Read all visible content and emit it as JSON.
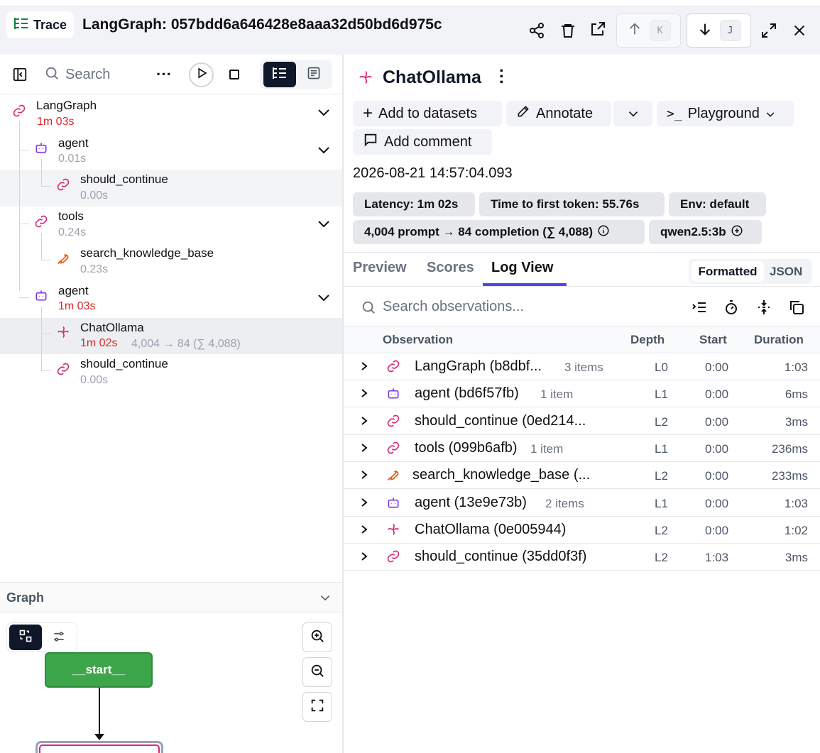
{
  "header": {
    "badge_label": "Trace",
    "title": "LangGraph: 057bdd6a646428e8aaa32d50bd6d975c",
    "prev_key": "K",
    "next_key": "J"
  },
  "left": {
    "search_label": "Search",
    "tree": [
      {
        "name": "LangGraph",
        "duration": "1m 03s",
        "dur_color": "red"
      },
      {
        "name": "agent",
        "duration": "0.01s",
        "dur_color": "gray"
      },
      {
        "name": "should_continue",
        "duration": "0.00s",
        "dur_color": "gray"
      },
      {
        "name": "tools",
        "duration": "0.24s",
        "dur_color": "gray"
      },
      {
        "name": "search_knowledge_base",
        "duration": "0.23s",
        "dur_color": "gray"
      },
      {
        "name": "agent",
        "duration": "1m 03s",
        "dur_color": "red"
      },
      {
        "name": "ChatOllama",
        "duration": "1m 02s",
        "tokens": "4,004 → 84 (∑ 4,088)",
        "dur_color": "red"
      },
      {
        "name": "should_continue",
        "duration": "0.00s",
        "dur_color": "gray"
      }
    ],
    "graph_label": "Graph",
    "graph_node_start": "__start__"
  },
  "right": {
    "obs_title": "ChatOllama",
    "buttons": {
      "add_to_datasets": "Add to datasets",
      "annotate": "Annotate",
      "playground": "Playground",
      "add_comment": "Add comment"
    },
    "timestamp": "2026-08-21 14:57:04.093",
    "tags": {
      "latency": "Latency: 1m 02s",
      "ttft": "Time to first token: 55.76s",
      "env": "Env: default",
      "tokens": "4,004 prompt → 84 completion (∑ 4,088)",
      "model": "qwen2.5:3b"
    },
    "tabs": {
      "preview": "Preview",
      "scores": "Scores",
      "log_view": "Log View"
    },
    "view_toggle": {
      "formatted": "Formatted",
      "json": "JSON"
    },
    "search_placeholder": "Search observations...",
    "columns": {
      "observation": "Observation",
      "depth": "Depth",
      "start": "Start",
      "duration": "Duration"
    },
    "rows": [
      {
        "name": "LangGraph (b8dbf...",
        "items": "3 items",
        "depth": "L0",
        "start": "0:00",
        "duration": "1:03",
        "icon": "link"
      },
      {
        "name": "agent (bd6f57fb)",
        "items": "1 item",
        "depth": "L1",
        "start": "0:00",
        "duration": "6ms",
        "icon": "bot"
      },
      {
        "name": "should_continue (0ed214...",
        "items": "",
        "depth": "L2",
        "start": "0:00",
        "duration": "3ms",
        "icon": "link"
      },
      {
        "name": "tools (099b6afb)",
        "items": "1 item",
        "depth": "L1",
        "start": "0:00",
        "duration": "236ms",
        "icon": "link"
      },
      {
        "name": "search_knowledge_base (...",
        "items": "",
        "depth": "L2",
        "start": "0:00",
        "duration": "233ms",
        "icon": "wrench"
      },
      {
        "name": "agent (13e9e73b)",
        "items": "2 items",
        "depth": "L1",
        "start": "0:00",
        "duration": "1:03",
        "icon": "bot"
      },
      {
        "name": "ChatOllama (0e005944)",
        "items": "",
        "depth": "L2",
        "start": "0:00",
        "duration": "1:02",
        "icon": "gen"
      },
      {
        "name": "should_continue (35dd0f3f)",
        "items": "",
        "depth": "L2",
        "start": "1:03",
        "duration": "3ms",
        "icon": "link"
      }
    ]
  },
  "colors": {
    "accent": "#4f46e5",
    "link_pink": "#db2777",
    "bot_purple": "#7c3aed",
    "wrench_orange": "#ea580c",
    "start_green": "#3da64a",
    "dur_red": "#dc2626"
  }
}
